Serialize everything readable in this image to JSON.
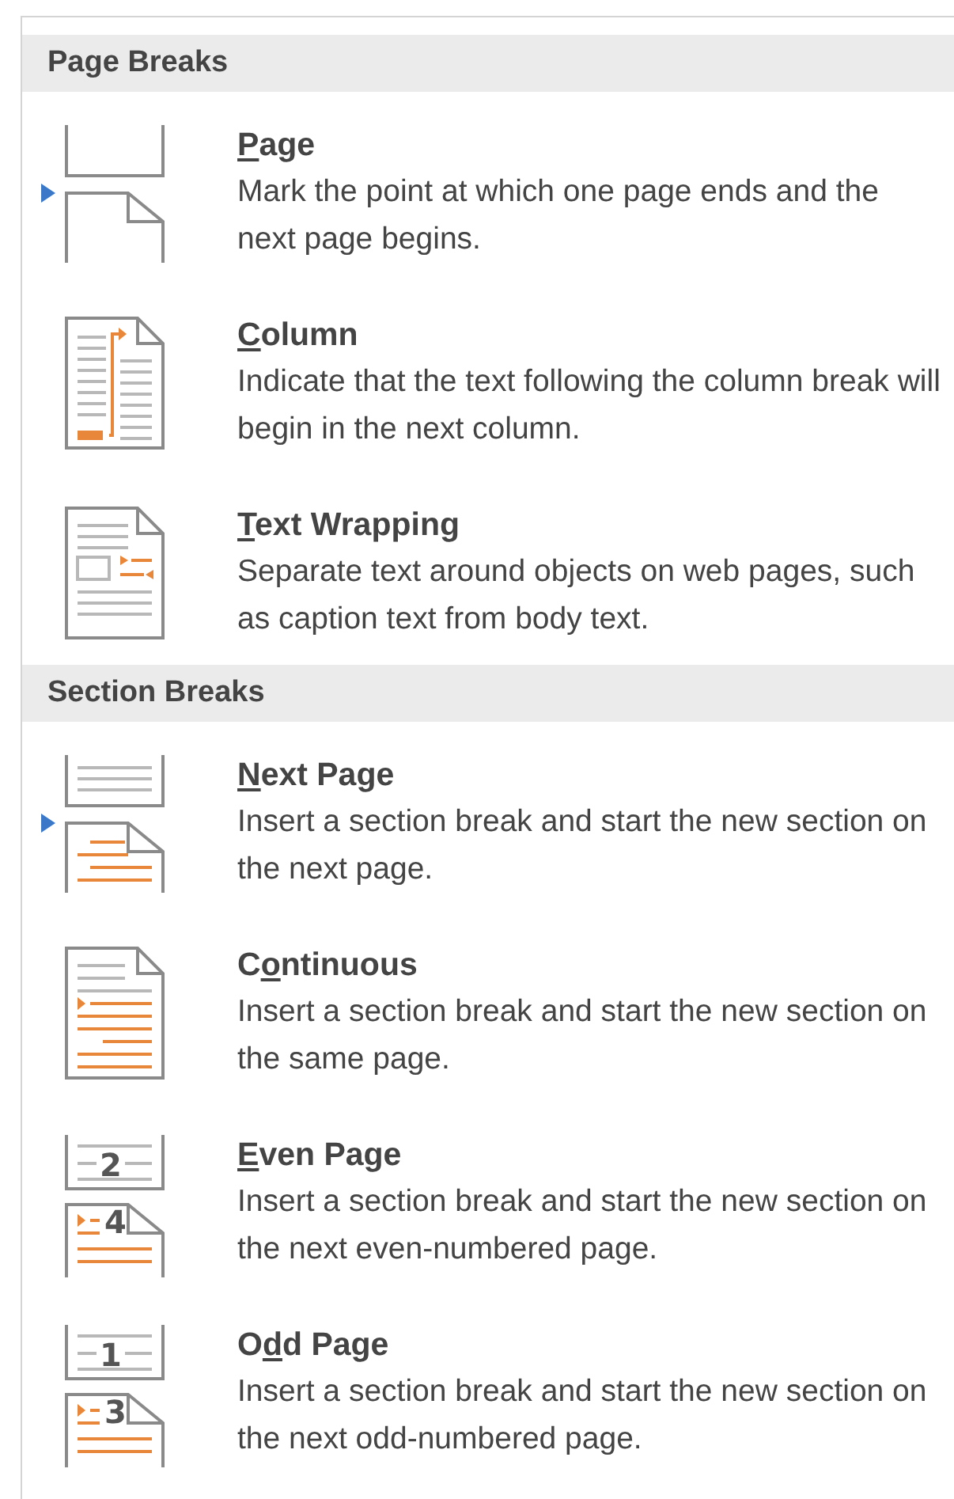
{
  "sections": [
    {
      "title": "Page Breaks",
      "items": [
        {
          "kind": "page",
          "label_parts": [
            {
              "text": "P",
              "underlined": true
            },
            {
              "text": "age",
              "underlined": false
            }
          ],
          "description": "Mark the point at which one page ends and the next page begins.",
          "marked": true
        },
        {
          "kind": "column",
          "label_parts": [
            {
              "text": "C",
              "underlined": true
            },
            {
              "text": "olumn",
              "underlined": false
            }
          ],
          "description": "Indicate that the text following the column break will begin in the next column.",
          "marked": false
        },
        {
          "kind": "text_wrapping",
          "label_parts": [
            {
              "text": "T",
              "underlined": true
            },
            {
              "text": "ext Wrapping",
              "underlined": false
            }
          ],
          "description": "Separate text around objects on web pages, such as caption text from body text.",
          "marked": false
        }
      ]
    },
    {
      "title": "Section Breaks",
      "items": [
        {
          "kind": "next_page",
          "label_parts": [
            {
              "text": "N",
              "underlined": true
            },
            {
              "text": "ext Page",
              "underlined": false
            }
          ],
          "description": "Insert a section break and start the new section on the next page.",
          "marked": true
        },
        {
          "kind": "continuous",
          "label_parts": [
            {
              "text": "C",
              "underlined": false
            },
            {
              "text": "o",
              "underlined": true
            },
            {
              "text": "ntinuous",
              "underlined": false
            }
          ],
          "description": "Insert a section break and start the new section on the same page.",
          "marked": false
        },
        {
          "kind": "numbered_page",
          "label_parts": [
            {
              "text": "E",
              "underlined": true
            },
            {
              "text": "ven Page",
              "underlined": false
            }
          ],
          "description": "Insert a section break and start the new section on the next even-numbered page.",
          "marked": false,
          "icon_digits": [
            "2",
            "4"
          ]
        },
        {
          "kind": "numbered_page",
          "label_parts": [
            {
              "text": "O",
              "underlined": false
            },
            {
              "text": "d",
              "underlined": true
            },
            {
              "text": "d Page",
              "underlined": false
            }
          ],
          "description": "Insert a section break and start the new section on the next odd-numbered page.",
          "marked": false,
          "icon_digits": [
            "1",
            "3"
          ]
        }
      ]
    }
  ]
}
